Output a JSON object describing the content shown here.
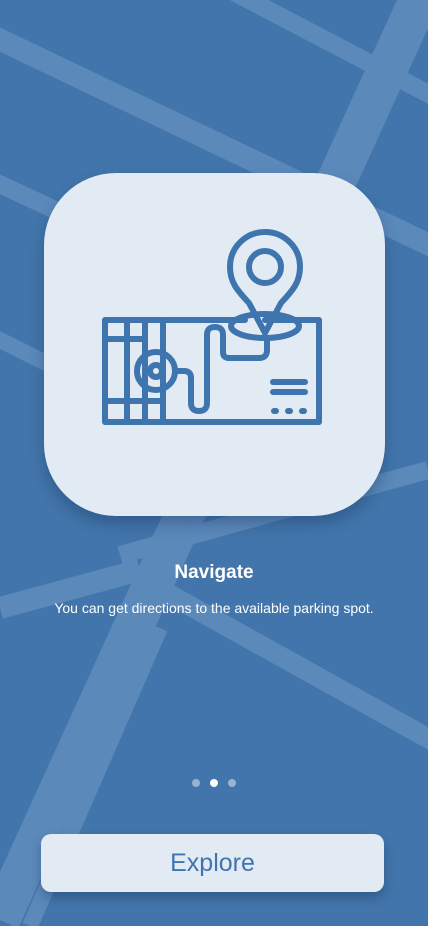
{
  "colors": {
    "background": "#4275ab",
    "road": "#5b89ba",
    "card": "#e2ebf4",
    "icon": "#3f75ae",
    "button_background": "#e2ebf4",
    "button_text": "#3f75ae"
  },
  "illustration": {
    "icon": "map-location-pin-icon"
  },
  "onboarding": {
    "title": "Navigate",
    "description": "You can get directions to the available parking spot."
  },
  "pagination": {
    "total": 3,
    "current": 2
  },
  "cta": {
    "label": "Explore"
  }
}
